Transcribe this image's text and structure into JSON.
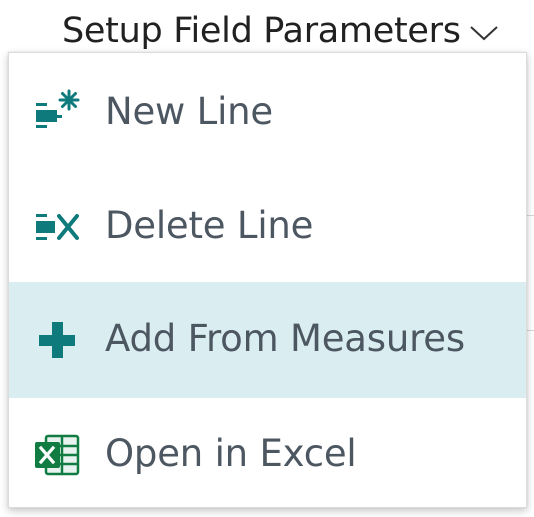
{
  "header": {
    "title": "Setup Field Parameters"
  },
  "menu": {
    "items": [
      {
        "label": "New Line",
        "icon": "new-line-icon"
      },
      {
        "label": "Delete Line",
        "icon": "delete-line-icon"
      },
      {
        "label": "Add From Measures",
        "icon": "plus-icon"
      },
      {
        "label": "Open in Excel",
        "icon": "excel-icon"
      }
    ]
  },
  "colors": {
    "accent": "#0e7a7c",
    "hover_bg": "#daeef1",
    "label_text": "#4d5761"
  }
}
